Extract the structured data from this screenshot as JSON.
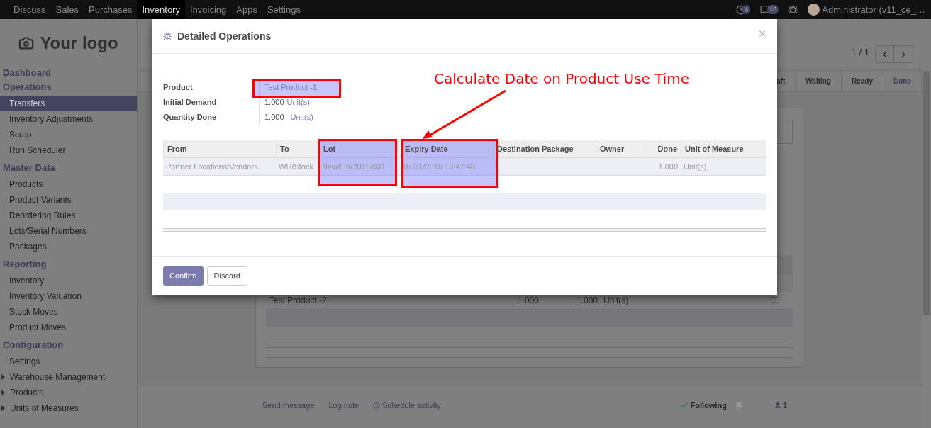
{
  "top_menu": [
    {
      "label": "Discuss",
      "selected": false
    },
    {
      "label": "Sales",
      "selected": false
    },
    {
      "label": "Purchases",
      "selected": false
    },
    {
      "label": "Inventory",
      "selected": true
    },
    {
      "label": "Invoicing",
      "selected": false
    },
    {
      "label": "Apps",
      "selected": false
    },
    {
      "label": "Settings",
      "selected": false
    }
  ],
  "systray": {
    "activity_count": "4",
    "message_count": "10",
    "user": "Administrator (v11_ce_…"
  },
  "sidebar": {
    "logo_text": "Your logo",
    "sections": [
      {
        "title": "Dashboard"
      },
      {
        "title": "Operations",
        "items": [
          {
            "label": "Transfers",
            "selected": true,
            "kind": "entry"
          },
          {
            "label": "Inventory Adjustments",
            "selected": false,
            "kind": "entry"
          },
          {
            "label": "Scrap",
            "selected": false,
            "kind": "entry"
          },
          {
            "label": "Run Scheduler",
            "selected": false,
            "kind": "entry"
          }
        ]
      },
      {
        "title": "Master Data",
        "items": [
          {
            "label": "Products",
            "selected": false,
            "kind": "entry"
          },
          {
            "label": "Product Variants",
            "selected": false,
            "kind": "entry"
          },
          {
            "label": "Reordering Rules",
            "selected": false,
            "kind": "entry"
          },
          {
            "label": "Lots/Serial Numbers",
            "selected": false,
            "kind": "entry"
          },
          {
            "label": "Packages",
            "selected": false,
            "kind": "entry"
          }
        ]
      },
      {
        "title": "Reporting",
        "items": [
          {
            "label": "Inventory",
            "selected": false,
            "kind": "entry"
          },
          {
            "label": "Inventory Valuation",
            "selected": false,
            "kind": "entry"
          },
          {
            "label": "Stock Moves",
            "selected": false,
            "kind": "entry"
          },
          {
            "label": "Product Moves",
            "selected": false,
            "kind": "entry"
          }
        ]
      },
      {
        "title": "Configuration",
        "items": [
          {
            "label": "Settings",
            "selected": false,
            "kind": "entry"
          },
          {
            "label": "Warehouse Management",
            "selected": false,
            "kind": "folder"
          },
          {
            "label": "Products",
            "selected": false,
            "kind": "folder"
          },
          {
            "label": "Units of Measures",
            "selected": false,
            "kind": "folder"
          }
        ]
      }
    ]
  },
  "pager": "1 / 1",
  "statusbar": [
    {
      "label": "aft",
      "selected": false
    },
    {
      "label": "Waiting",
      "selected": false
    },
    {
      "label": "Ready",
      "selected": false
    },
    {
      "label": "Done",
      "selected": true
    }
  ],
  "sheet": {
    "rows": [
      {
        "product": "Test Product -2",
        "initial_demand": "1.000",
        "done": "1.000",
        "unit": "Unit(s)"
      }
    ]
  },
  "chatter": {
    "send_message": "Send message",
    "log_note": "Log note",
    "schedule_activity": "Schedule activity",
    "following": "Following",
    "followers": "1"
  },
  "dialog": {
    "title": "Detailed Operations",
    "close": "×",
    "fields": [
      {
        "label": "Product",
        "value": "Test Product -1",
        "kind": "link"
      },
      {
        "label": "Initial Demand",
        "value": "1.000",
        "unit": "Unit(s)",
        "kind": "quantity"
      },
      {
        "label": "Quantity Done",
        "value": "1.000",
        "unit": "Unit(s)",
        "kind": "quantity"
      }
    ],
    "table": {
      "columns": [
        "From",
        "To",
        "Lot",
        "Expiry Date",
        "Destination Package",
        "Owner",
        "Done",
        "Unit of Measure"
      ],
      "rows": [
        {
          "cells": [
            "Partner Locations/Vendors",
            "WH/Stock",
            "New/Lot/2019/001",
            "07/31/2019 10:47:48",
            null,
            null,
            "1.000",
            "Unit(s)"
          ]
        }
      ]
    },
    "buttons": [
      {
        "label": "Confirm",
        "kind": "primary"
      },
      {
        "label": "Discard",
        "kind": "secondary"
      }
    ]
  },
  "annotation": {
    "text": "Calculate Date on Product Use Time"
  }
}
